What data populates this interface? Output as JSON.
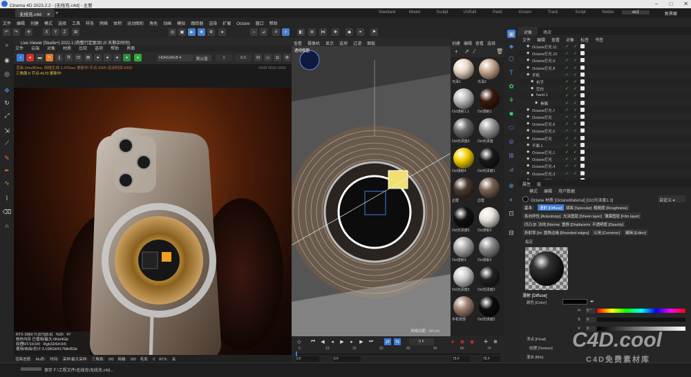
{
  "titlebar": {
    "title": "Cinema 4D 2023.2.2 - [无线充.c4d] - 主要",
    "min": "–",
    "max": "□",
    "close": "✕"
  },
  "doc_tab": "无线充.c4d",
  "layouts": [
    "Standard",
    "Model",
    "Sculpt",
    "UVEdit",
    "Paint",
    "Groom",
    "Track",
    "Script",
    "Nodes",
    "oc1"
  ],
  "layout_active": "oc1",
  "new_layout": "新界面",
  "menu": [
    "文件",
    "编辑",
    "创建",
    "模式",
    "选择",
    "工具",
    "样条",
    "网格",
    "体积",
    "运动图形",
    "角色",
    "动画",
    "模拟",
    "跟踪器",
    "渲染",
    "扩展",
    "Octane",
    "窗口",
    "帮助"
  ],
  "maintool_xyz": [
    "X",
    "Y",
    "Z"
  ],
  "live_viewer": {
    "title": "Live Viewer [Studio+] 2022.1 [肉整行定驱动] (0 天剩余时间)",
    "menu": [
      "文件",
      "云端",
      "对象",
      "材质",
      "比较",
      "选项",
      "帮助",
      "界面"
    ],
    "color_space": "HDR/sRGB",
    "tonemap": "默认值",
    "val1": "1",
    "val2": "0.3",
    "status1": "渲染:3ms/80ms. 网格生成:1.476sec 更新中:节点:2005 运动时间:2005",
    "status2": "三角面:0 节点:4170 更新中:",
    "status_right": "0608 0000 0000"
  },
  "gpu": {
    "line1": "RTX 3060 Ti [DT][8.6]",
    "line1b": "%20",
    "line1c": "47",
    "line2": "核外内存 已使用/最大:0Kb/4Gb",
    "line3": "纹理RT/16:0/0",
    "line3b": "Rgb32/64:0/0",
    "line4": "使用/自由/总计:3.168Gb/517Mb/8Gb"
  },
  "bottominfo": {
    "items": [
      "渲染进度:",
      "Mu秒:",
      "时间:",
      "采样/最大采样:",
      "三角面:",
      "0/0",
      "网格:",
      "0/0",
      "毛发:",
      "0",
      "RTX:",
      "关"
    ]
  },
  "viewport": {
    "menu": [
      "查看",
      "摄像机",
      "显示",
      "选项",
      "过滤",
      "面板"
    ],
    "label": "透视视图",
    "grid": "网格间距 : 50 cm"
  },
  "timeline": {
    "frame": "0 F",
    "ticks": [
      "0",
      "10",
      "20",
      "30",
      "40",
      "50",
      "60",
      "70"
    ],
    "start": "0 F",
    "start2": "0 F",
    "end": "75 F",
    "end2": "75 F"
  },
  "materials": {
    "menu": [
      "创建",
      "编辑",
      "查看",
      "选择"
    ],
    "items": [
      {
        "label": "光泽1",
        "color": "#e8d6c4"
      },
      {
        "label": "光泽2",
        "color": "#caa990"
      },
      {
        "label": "Oct漫射1.1",
        "color": "#bdbdbd"
      },
      {
        "label": "Oct漫射1",
        "color": "#3a1a0c"
      },
      {
        "label": "Oct光泽度3",
        "color": "#6a6a6a"
      },
      {
        "label": "Oct光泽度",
        "color": "#999"
      },
      {
        "label": "Oct漫射4",
        "color": "#f2d000"
      },
      {
        "label": "Oct光泽度1",
        "color": "#1a1a1a"
      },
      {
        "label": "边框",
        "color": "#4a3a30"
      },
      {
        "label": "边框",
        "color": "#7a6052"
      },
      {
        "label": "Oct光泽度5",
        "color": "#111"
      },
      {
        "label": "Oct漫射2",
        "color": "#e8e0d8"
      },
      {
        "label": "Oct漫射3",
        "color": "#aaa"
      },
      {
        "label": "Oct漫射2",
        "color": "#888"
      },
      {
        "label": "Oct光泽度3",
        "color": "#ccc"
      },
      {
        "label": "Oct光泽度2",
        "color": "#222"
      },
      {
        "label": "手机背部",
        "color": "#a08070"
      },
      {
        "label": "Oct光泽度2",
        "color": "#0d0d0d"
      }
    ]
  },
  "objects": {
    "tabs": [
      "对象",
      "场次"
    ],
    "menu": [
      "文件",
      "编辑",
      "查看",
      "对象",
      "标签",
      "书签"
    ],
    "rows": [
      {
        "name": "Octane灯光.11",
        "indent": 0
      },
      {
        "name": "Octane灯光.10",
        "indent": 0
      },
      {
        "name": "Octane灯光.9",
        "indent": 0
      },
      {
        "name": "Octane灯光.8",
        "indent": 0
      },
      {
        "name": "手机",
        "indent": 0
      },
      {
        "name": "右手",
        "indent": 1
      },
      {
        "name": "空白",
        "indent": 1
      },
      {
        "name": "hand.1",
        "indent": 1
      },
      {
        "name": "骨骼",
        "indent": 2
      },
      {
        "name": "Octane灯光.7",
        "indent": 0
      },
      {
        "name": "Octane灯光",
        "indent": 0
      },
      {
        "name": "Octane灯光.6",
        "indent": 0
      },
      {
        "name": "Octane灯光.5",
        "indent": 0
      },
      {
        "name": "Octane灯光",
        "indent": 0
      },
      {
        "name": "平面.1",
        "indent": 0
      },
      {
        "name": "Octane灯光.1",
        "indent": 0
      },
      {
        "name": "Octane灯光",
        "indent": 0
      },
      {
        "name": "Octane灯光.4",
        "indent": 0
      },
      {
        "name": "Octane灯光.3",
        "indent": 0
      },
      {
        "name": "Octane灯光",
        "indent": 0
      }
    ]
  },
  "attributes": {
    "tabs": [
      "属性",
      "层"
    ],
    "menu": [
      "模式",
      "编辑",
      "用户数据"
    ],
    "name": "Octane 材质 [OctaneMaterial] [Oct光泽度1.3]",
    "preset": "自定义",
    "ptabs": [
      {
        "label": "基本",
        "act": false
      },
      {
        "label": "漫射 [Diffuse]",
        "act": true
      },
      {
        "label": "镜面 [Specular]",
        "act": false
      },
      {
        "label": "粗糙度 [Roughness]",
        "act": false
      },
      {
        "label": "各向异性 [Anisotropy]",
        "act": false
      },
      {
        "label": "光泽图层 [Sheen layer]",
        "act": false
      },
      {
        "label": "薄膜图层 [Film layer]",
        "act": false
      },
      {
        "label": "凹凸 [Bump]",
        "act": false
      },
      {
        "label": "法线 [Normal]",
        "act": false
      },
      {
        "label": "置换 [Displacement]",
        "act": false
      },
      {
        "label": "不透明度 [Opacity]",
        "act": false
      },
      {
        "label": "折射率 [Index]",
        "act": false
      },
      {
        "label": "圆角边缘 [Rounded edges]",
        "act": false
      },
      {
        "label": "公用 [Common]",
        "act": false
      },
      {
        "label": "编辑 [Editor]",
        "act": false
      }
    ],
    "assign": "指定",
    "section": "漫射 [Diffuse]",
    "color_label": "颜色 [Color]",
    "h": "H",
    "h_val": "0 °",
    "s": "S",
    "s_val": "0",
    "v": "V",
    "v_val": "0",
    "float_label": "浮点 [Float]",
    "texture_label": "纹理 [Texture]",
    "mix_label": "混合 [Mix]"
  },
  "statusbar": {
    "text": "保存 F:\\工程文件\\无线充\\无线充.c4d..."
  },
  "watermark": {
    "logo": "C4D.cool",
    "sub": "C4D免费素材库"
  }
}
